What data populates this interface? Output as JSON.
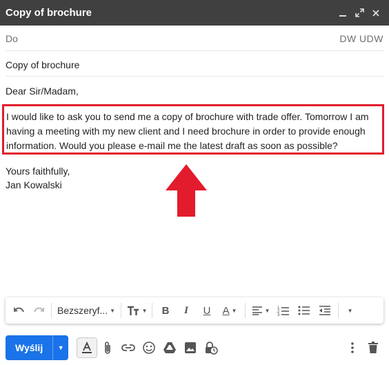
{
  "window": {
    "title": "Copy of brochure",
    "controls": [
      "minimize-icon",
      "expand-icon",
      "close-icon"
    ]
  },
  "recipients": {
    "to_label": "Do",
    "cc_bcc_label": "DW UDW"
  },
  "subject": "Copy of brochure",
  "message": {
    "greeting": "Dear Sir/Madam,",
    "highlighted_paragraph": "I would like to ask you to send me a copy of brochure with trade offer. Tomorrow I am having a meeting with my new client and I need brochure in order to provide enough information. Would you please e-mail me the latest draft as soon as possible?",
    "closing": "Yours faithfully,",
    "signature": "Jan Kowalski"
  },
  "formatting_toolbar": {
    "font_name": "Bezszeryf..."
  },
  "bottom_toolbar": {
    "send_label": "Wyślij"
  },
  "colors": {
    "titlebar": "#404040",
    "highlight_border": "#e21c2c",
    "arrow": "#e21c2c",
    "send_button": "#1a73e8"
  }
}
